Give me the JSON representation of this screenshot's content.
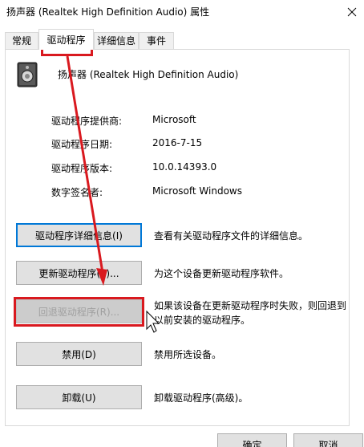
{
  "window": {
    "title": "扬声器 (Realtek High Definition Audio) 属性"
  },
  "tabs": [
    {
      "label": "常规"
    },
    {
      "label": "驱动程序"
    },
    {
      "label": "详细信息"
    },
    {
      "label": "事件"
    }
  ],
  "device": {
    "name": "扬声器 (Realtek High Definition Audio)",
    "icon": "speaker-icon"
  },
  "info": [
    {
      "label": "驱动程序提供商:",
      "value": "Microsoft"
    },
    {
      "label": "驱动程序日期:",
      "value": "2016-7-15"
    },
    {
      "label": "驱动程序版本:",
      "value": "10.0.14393.0"
    },
    {
      "label": "数字签名者:",
      "value": "Microsoft Windows"
    }
  ],
  "actions": [
    {
      "label": "驱动程序详细信息(I)",
      "desc": "查看有关驱动程序文件的详细信息。"
    },
    {
      "label": "更新驱动程序(P)...",
      "desc": "为这个设备更新驱动程序软件。"
    },
    {
      "label": "回退驱动程序(R)...",
      "desc": "如果该设备在更新驱动程序时失败，则回退到以前安装的驱动程序。"
    },
    {
      "label": "禁用(D)",
      "desc": "禁用所选设备。"
    },
    {
      "label": "卸载(U)",
      "desc": "卸载驱动程序(高级)。"
    }
  ],
  "footer": {
    "ok_label": "确定",
    "cancel_label": "取消"
  },
  "colors": {
    "annotation": "#d9191f",
    "focus": "#0078d7"
  }
}
